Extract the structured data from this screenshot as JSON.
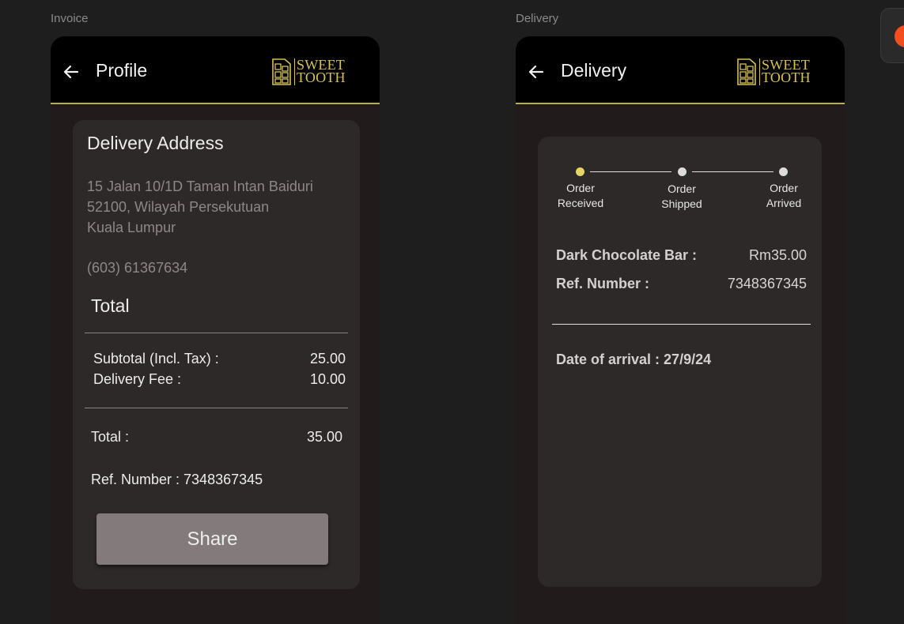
{
  "frames": {
    "invoice_label": "Invoice",
    "delivery_label": "Delivery"
  },
  "invoice": {
    "header_title": "Profile",
    "logo": {
      "line1": "SWEET",
      "line2": "TOOTH"
    },
    "address_heading": "Delivery Address",
    "address_lines": [
      "15 Jalan 10/1D Taman Intan Baiduri",
      "52100, Wilayah Persekutuan",
      "Kuala Lumpur"
    ],
    "phone": "(603) 61367634",
    "total_heading": "Total",
    "subtotal_label": "Subtotal (Incl. Tax) :",
    "subtotal_value": "25.00",
    "delivery_fee_label": "Delivery Fee :",
    "delivery_fee_value": "10.00",
    "total_label": "Total :",
    "total_value": "35.00",
    "ref_line": "Ref. Number : 7348367345",
    "share_label": "Share"
  },
  "delivery": {
    "header_title": "Delivery",
    "logo": {
      "line1": "SWEET",
      "line2": "TOOTH"
    },
    "steps": [
      {
        "line1": "Order",
        "line2": "Received",
        "active": true
      },
      {
        "line1": "Order",
        "line2": "Shipped",
        "active": false
      },
      {
        "line1": "Order",
        "line2": "Arrived",
        "active": false
      }
    ],
    "item_label": "Dark Chocolate Bar :",
    "item_price": "Rm35.00",
    "ref_label": "Ref. Number :",
    "ref_value": "7348367345",
    "arrival_line": "Date of arrival : 27/9/24"
  },
  "colors": {
    "accent": "#b6ad54",
    "step_active": "#e6d464",
    "step_inactive": "#dcdcdc",
    "card": "#2e2929",
    "frame_bg": "#211b1b"
  }
}
